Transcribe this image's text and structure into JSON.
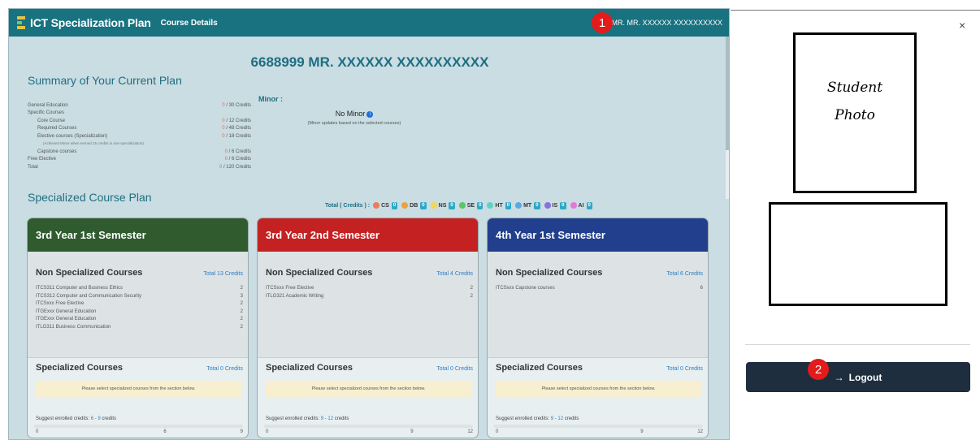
{
  "navbar": {
    "brand": "ICT Specialization Plan",
    "course_details": "Course Details",
    "user_name": "MR. MR. XXXXXX XXXXXXXXXX",
    "marker": "1"
  },
  "student": {
    "title": "6688999 MR. XXXXXX XXXXXXXXXX"
  },
  "summary": {
    "title": "Summary of Your Current Plan",
    "rows": [
      {
        "label": "General Education",
        "value": "0",
        "suffix": "/ 30  Credits"
      },
      {
        "label": "Specific Courses",
        "value": "",
        "suffix": ""
      },
      {
        "label": "Core Course",
        "value": "0",
        "suffix": "/ 12  Credits"
      },
      {
        "label": "Required Courses",
        "value": "0",
        "suffix": "/ 48  Credits"
      },
      {
        "label": "Elective courses (Specialization)",
        "value": "0",
        "suffix": "/ 18  Credits"
      },
      {
        "label": "(Achieved Minor when earned 15 credits in one specialization)",
        "value": "",
        "suffix": ""
      },
      {
        "label": "Capstone courses",
        "value": "0",
        "suffix": "/ 6    Credits"
      },
      {
        "label": "Free Elective",
        "value": "0",
        "suffix": "/ 6    Credits"
      },
      {
        "label": "Total",
        "value": "0",
        "suffix": "/ 120 Credits"
      }
    ]
  },
  "minor": {
    "label": "Minor :",
    "value": "No Minor",
    "info_icon": "i",
    "hint": "(Minor updates based on the selected courses)"
  },
  "plan": {
    "title": "Specialized Course Plan",
    "totals_label": "Total ( Credits ) :",
    "tags": [
      {
        "name": "CS",
        "color": "#f07a5a",
        "count": "0"
      },
      {
        "name": "DB",
        "color": "#f0a03a",
        "count": "0"
      },
      {
        "name": "NS",
        "color": "#f2d65a",
        "count": "0"
      },
      {
        "name": "SE",
        "color": "#5cc56a",
        "count": "0"
      },
      {
        "name": "HT",
        "color": "#5fd3c3",
        "count": "0"
      },
      {
        "name": "MT",
        "color": "#5aa9e6",
        "count": "0"
      },
      {
        "name": "IS",
        "color": "#8a6fe0",
        "count": "0"
      },
      {
        "name": "AI",
        "color": "#e07ad8",
        "count": "0"
      }
    ]
  },
  "semesters": [
    {
      "title": "3rd Year 1st Semester",
      "color": "#2f5b2f",
      "non_spec_title": "Non Specialized Courses",
      "non_spec_total": "Total 13 Credits",
      "courses": [
        {
          "name": "ITCS311  Computer and Business Ethics",
          "credits": "2"
        },
        {
          "name": "ITCS312  Computer and Communication Security",
          "credits": "3"
        },
        {
          "name": "ITCSxxx  Free Elective",
          "credits": "2"
        },
        {
          "name": "ITGExxx  General Education",
          "credits": "2"
        },
        {
          "name": "ITGExxx  General Education",
          "credits": "2"
        },
        {
          "name": "ITLG311  Business Communication",
          "credits": "2"
        }
      ],
      "spec_title": "Specialized Courses",
      "spec_total": "Total 0 Credits",
      "notice": "Please select specialized courses from the section below.",
      "suggest_label": "Suggest enrolled credits:",
      "suggest_range": "6 - 9",
      "suggest_unit": "credits",
      "ticks": [
        "0",
        "6",
        "9"
      ]
    },
    {
      "title": "3rd Year 2nd Semester",
      "color": "#c42222",
      "non_spec_title": "Non Specialized Courses",
      "non_spec_total": "Total 4 Credits",
      "courses": [
        {
          "name": "ITCSxxx  Free Elective",
          "credits": "2"
        },
        {
          "name": "ITLG321  Academic Writing",
          "credits": "2"
        }
      ],
      "spec_title": "Specialized Courses",
      "spec_total": "Total 0 Credits",
      "notice": "Please select specialized courses from the section below.",
      "suggest_label": "Suggest enrolled credits:",
      "suggest_range": "9 - 12",
      "suggest_unit": "credits",
      "ticks": [
        "0",
        "9",
        "12"
      ]
    },
    {
      "title": "4th Year 1st Semester",
      "color": "#213f8c",
      "non_spec_title": "Non Specialized Courses",
      "non_spec_total": "Total 6 Credits",
      "courses": [
        {
          "name": "ITCSxxx  Capstone courses",
          "credits": "6"
        }
      ],
      "spec_title": "Specialized Courses",
      "spec_total": "Total 0 Credits",
      "notice": "Please select specialized courses from the section below.",
      "suggest_label": "Suggest enrolled credits:",
      "suggest_range": "9 - 12",
      "suggest_unit": "credits",
      "ticks": [
        "0",
        "9",
        "12"
      ]
    }
  ],
  "panel": {
    "close": "×",
    "photo_line1": "Student",
    "photo_line2": "Photo",
    "logout": "Logout",
    "logout_icon": "→",
    "marker": "2"
  }
}
